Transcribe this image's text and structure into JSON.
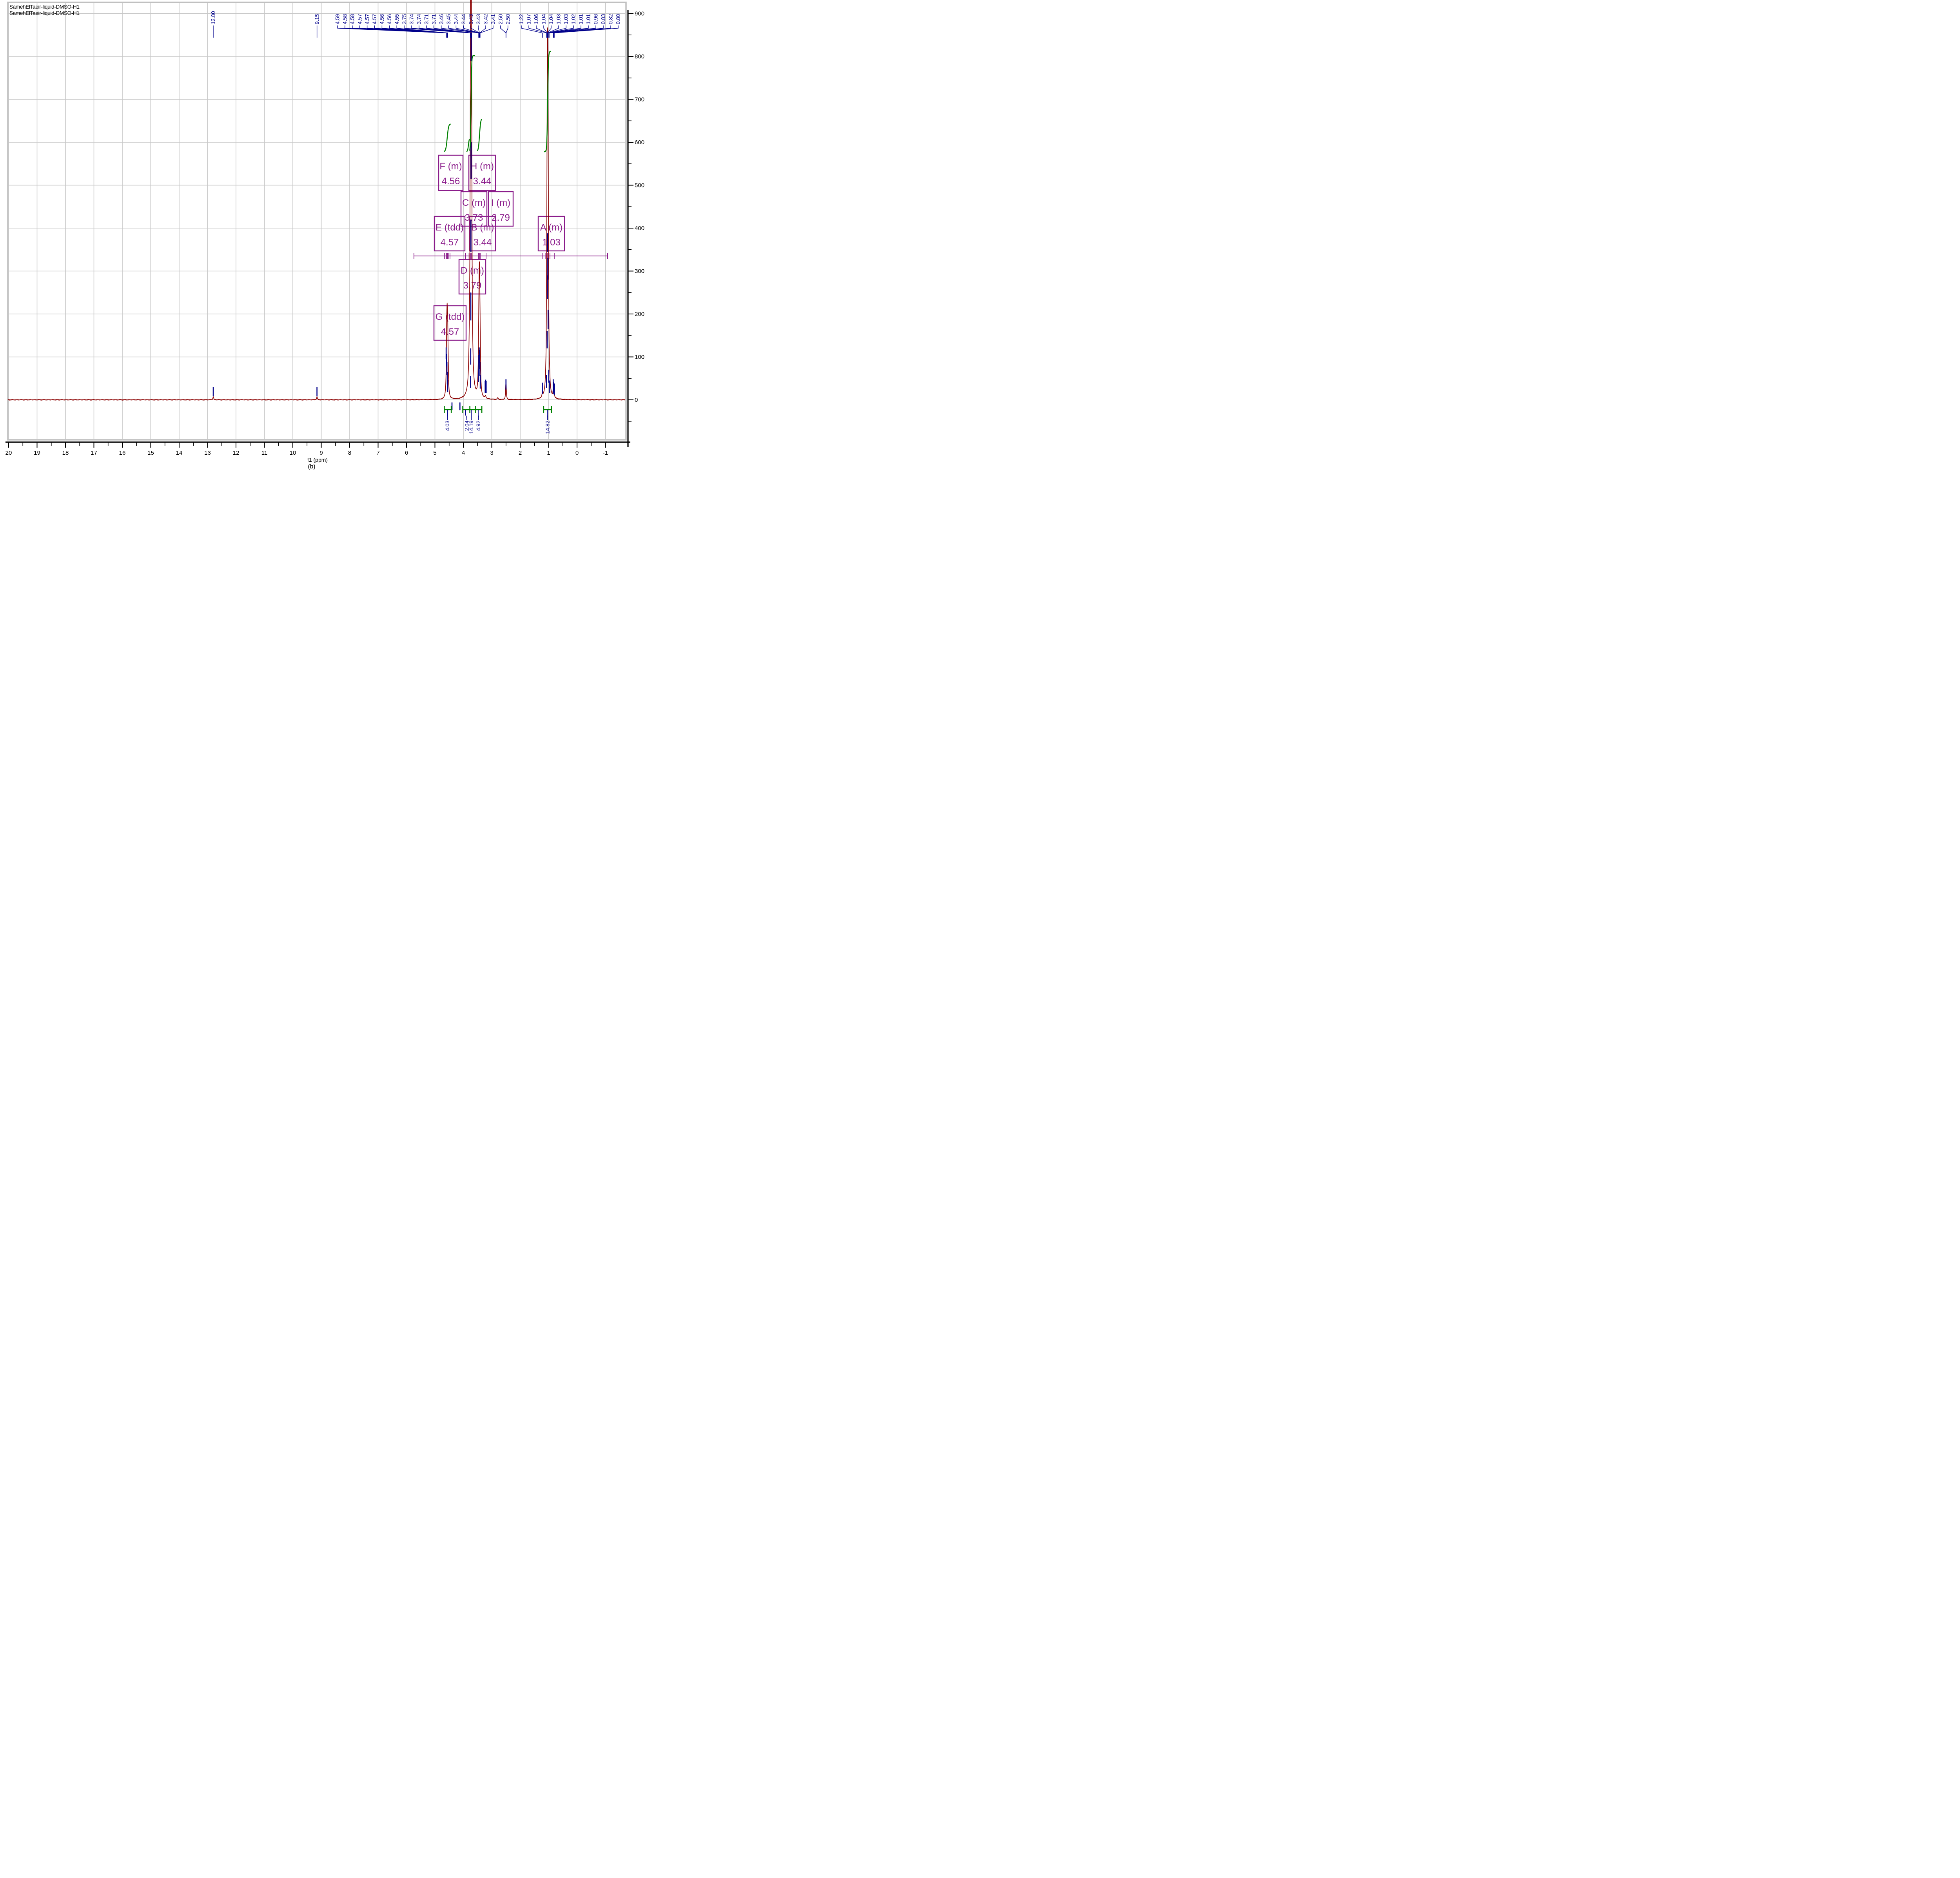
{
  "header": {
    "title_line1": "SamehElTaeir-liquid-DMSO-H1",
    "title_line2": "SamehElTaeir-liquid-DMSO-H1"
  },
  "caption": "(b)",
  "chart_data": {
    "type": "line",
    "title": "SamehElTaeir-liquid-DMSO-H1",
    "xlabel": "f1 (ppm)",
    "ylabel": "",
    "x_axis": {
      "label": "f1 (ppm)",
      "range": [
        20,
        -1
      ],
      "major_tick_step": 1,
      "minor_tick_step": 0.5,
      "tick_labels": [
        "20",
        "19",
        "18",
        "17",
        "16",
        "15",
        "14",
        "13",
        "12",
        "11",
        "10",
        "9",
        "8",
        "7",
        "6",
        "5",
        "4",
        "3",
        "2",
        "1",
        "0",
        "-1"
      ]
    },
    "y_axis": {
      "range": [
        0,
        900
      ],
      "major_tick_step": 100,
      "minor_tick_step": 50,
      "tick_labels": [
        "900",
        "800",
        "700",
        "600",
        "500",
        "400",
        "300",
        "200",
        "100",
        "0"
      ]
    },
    "grid": true,
    "peak_pick_clusters": [
      {
        "labels": [
          {
            "text": "12.80",
            "ppm": 12.8
          }
        ]
      },
      {
        "labels": [
          {
            "text": "9.15",
            "ppm": 9.15
          }
        ]
      },
      {
        "labels": [
          {
            "text": "4.59",
            "ppm": 4.59
          },
          {
            "text": "4.58",
            "ppm": 4.58
          },
          {
            "text": "4.58",
            "ppm": 4.58
          },
          {
            "text": "4.57",
            "ppm": 4.57
          },
          {
            "text": "4.57",
            "ppm": 4.57
          },
          {
            "text": "4.57",
            "ppm": 4.57
          },
          {
            "text": "4.56",
            "ppm": 4.56
          },
          {
            "text": "4.56",
            "ppm": 4.56
          },
          {
            "text": "4.55",
            "ppm": 4.55
          },
          {
            "text": "3.75",
            "ppm": 3.75
          },
          {
            "text": "3.74",
            "ppm": 3.74
          },
          {
            "text": "3.74",
            "ppm": 3.74
          },
          {
            "text": "3.71",
            "ppm": 3.71
          },
          {
            "text": "3.71",
            "ppm": 3.71
          },
          {
            "text": "3.46",
            "ppm": 3.46
          },
          {
            "text": "3.45",
            "ppm": 3.45
          },
          {
            "text": "3.44",
            "ppm": 3.44
          },
          {
            "text": "3.44",
            "ppm": 3.44
          },
          {
            "text": "3.43",
            "ppm": 3.43
          },
          {
            "text": "3.43",
            "ppm": 3.43
          },
          {
            "text": "3.42",
            "ppm": 3.42
          },
          {
            "text": "3.41",
            "ppm": 3.41
          },
          {
            "text": "2.50",
            "ppm": 2.502
          },
          {
            "text": "2.50",
            "ppm": 2.498
          }
        ]
      },
      {
        "labels": [
          {
            "text": "1.22",
            "ppm": 1.22
          },
          {
            "text": "1.07",
            "ppm": 1.07
          },
          {
            "text": "1.06",
            "ppm": 1.06
          },
          {
            "text": "1.04",
            "ppm": 1.045
          },
          {
            "text": "1.04",
            "ppm": 1.04
          },
          {
            "text": "1.03",
            "ppm": 1.035
          },
          {
            "text": "1.03",
            "ppm": 1.03
          },
          {
            "text": "1.02",
            "ppm": 1.02
          },
          {
            "text": "1.01",
            "ppm": 1.012
          },
          {
            "text": "1.01",
            "ppm": 1.008
          },
          {
            "text": "0.96",
            "ppm": 0.96
          },
          {
            "text": "0.83",
            "ppm": 0.83
          },
          {
            "text": "0.82",
            "ppm": 0.82
          },
          {
            "text": "0.80",
            "ppm": 0.8
          }
        ]
      }
    ],
    "multiplets": [
      {
        "id": "F",
        "type": "m",
        "shift": "4.56",
        "label_line1": "F (m)",
        "label_line2": "4.56"
      },
      {
        "id": "H",
        "type": "m",
        "shift": "3.44",
        "label_line1": "H (m)",
        "label_line2": "3.44"
      },
      {
        "id": "C",
        "type": "m",
        "shift": "3.73",
        "label_line1": "C (m)",
        "label_line2": "3.73"
      },
      {
        "id": "I",
        "type": "m",
        "shift": "2.79",
        "label_line1": "I (m)",
        "label_line2": "2.79"
      },
      {
        "id": "E",
        "type": "tdd",
        "shift": "4.57",
        "label_line1": "E (tdd)",
        "label_line2": "4.57"
      },
      {
        "id": "B",
        "type": "m",
        "shift": "3.44",
        "label_line1": "B (m)",
        "label_line2": "3.44"
      },
      {
        "id": "A",
        "type": "m",
        "shift": "1.03",
        "label_line1": "A (m)",
        "label_line2": "1.03"
      },
      {
        "id": "D",
        "type": "m",
        "shift": "3.79",
        "label_line1": "D (m)",
        "label_line2": "3.79"
      },
      {
        "id": "G",
        "type": "tdd",
        "shift": "4.57",
        "label_line1": "G (tdd)",
        "label_line2": "4.57"
      }
    ],
    "integrals": [
      {
        "value": "4.03",
        "from": 4.67,
        "to": 4.425,
        "leader_from": 4.555,
        "label_at": 4.56
      },
      {
        "value": "2.04",
        "from": 4.02,
        "to": 3.77,
        "leader_from": 3.92,
        "label_at": 3.88
      },
      {
        "value": "14.19",
        "from": 3.77,
        "to": 3.565,
        "leader_from": 3.72,
        "label_at": 3.72
      },
      {
        "value": "4.92",
        "from": 3.565,
        "to": 3.35,
        "leader_from": 3.46,
        "label_at": 3.47
      },
      {
        "value": "14.82",
        "from": 1.175,
        "to": 0.9,
        "leader_from": 1.035,
        "label_at": 1.04
      }
    ],
    "integral_curves": [
      {
        "from": 4.665,
        "to": 4.455,
        "center": 4.568,
        "w": 3.5,
        "I0": 578,
        "I1": 643
      },
      {
        "from": 3.875,
        "to": 3.788,
        "center": 3.82,
        "w": 2.2,
        "I0": 578,
        "I1": 611
      },
      {
        "from": 3.775,
        "to": 3.6,
        "center": 3.729,
        "w": 1.6,
        "I0": 578,
        "I1": 802
      },
      {
        "from": 3.5,
        "to": 3.355,
        "center": 3.43,
        "w": 3.0,
        "I0": 578,
        "I1": 656
      },
      {
        "from": 1.155,
        "to": 0.925,
        "center": 1.034,
        "w": 2.0,
        "I0": 578,
        "I1": 812
      }
    ],
    "peaks": [
      [
        12.8,
        7,
        1.2
      ],
      [
        9.15,
        7,
        1.2
      ],
      [
        4.6,
        22,
        0.9
      ],
      [
        4.585,
        95,
        1.0
      ],
      [
        4.57,
        128,
        1.1
      ],
      [
        4.552,
        108,
        1.1
      ],
      [
        4.535,
        38,
        1.0
      ],
      [
        3.8,
        13,
        0.9
      ],
      [
        3.785,
        26,
        0.9
      ],
      [
        3.77,
        17,
        0.9
      ],
      [
        3.752,
        110,
        1.0
      ],
      [
        3.74,
        420,
        1.1
      ],
      [
        3.731,
        845,
        1.3
      ],
      [
        3.722,
        560,
        1.1
      ],
      [
        3.712,
        150,
        1.0
      ],
      [
        3.465,
        45,
        1.0
      ],
      [
        3.452,
        82,
        1.0
      ],
      [
        3.441,
        105,
        1.1
      ],
      [
        3.432,
        118,
        1.1
      ],
      [
        3.423,
        92,
        1.0
      ],
      [
        3.412,
        58,
        1.0
      ],
      [
        3.4,
        26,
        0.9
      ],
      [
        3.22,
        6,
        1.2
      ],
      [
        2.79,
        4,
        1.2
      ],
      [
        2.507,
        13,
        0.8
      ],
      [
        2.5,
        22,
        0.9
      ],
      [
        2.493,
        13,
        0.8
      ],
      [
        1.22,
        9,
        1.0
      ],
      [
        1.07,
        45,
        0.9
      ],
      [
        1.058,
        130,
        1.0
      ],
      [
        1.046,
        300,
        1.1
      ],
      [
        1.035,
        385,
        1.2
      ],
      [
        1.024,
        310,
        1.1
      ],
      [
        1.012,
        140,
        1.0
      ],
      [
        1.0,
        55,
        0.9
      ],
      [
        0.96,
        11,
        0.9
      ],
      [
        0.838,
        13,
        0.9
      ],
      [
        0.82,
        9,
        0.9
      ],
      [
        0.8,
        7,
        0.9
      ]
    ],
    "pick_ticks": [
      [
        12.8,
        8,
        30
      ],
      [
        9.15,
        8,
        30
      ],
      [
        4.605,
        95,
        122
      ],
      [
        4.592,
        78,
        107
      ],
      [
        4.578,
        58,
        88
      ],
      [
        4.565,
        36,
        65
      ],
      [
        4.551,
        18,
        46
      ],
      [
        3.745,
        28,
        55
      ],
      [
        3.741,
        82,
        120
      ],
      [
        3.737,
        185,
        250
      ],
      [
        3.733,
        345,
        420
      ],
      [
        3.729,
        515,
        600
      ],
      [
        3.726,
        790,
        855
      ],
      [
        3.468,
        42,
        72
      ],
      [
        3.455,
        72,
        105
      ],
      [
        3.443,
        92,
        122
      ],
      [
        3.43,
        86,
        116
      ],
      [
        3.418,
        55,
        88
      ],
      [
        3.405,
        26,
        58
      ],
      [
        3.232,
        16,
        44
      ],
      [
        3.215,
        18,
        47
      ],
      [
        3.198,
        16,
        44
      ],
      [
        2.5,
        24,
        48
      ],
      [
        1.22,
        14,
        40
      ],
      [
        1.075,
        28,
        58
      ],
      [
        1.052,
        120,
        160
      ],
      [
        1.043,
        235,
        290
      ],
      [
        1.036,
        345,
        388
      ],
      [
        1.028,
        280,
        330
      ],
      [
        1.018,
        165,
        210
      ],
      [
        0.995,
        40,
        70
      ],
      [
        0.96,
        16,
        45
      ],
      [
        0.838,
        18,
        48
      ],
      [
        0.822,
        14,
        42
      ],
      [
        0.8,
        12,
        38
      ],
      [
        4.4,
        -24,
        -6
      ],
      [
        4.12,
        -24,
        -6
      ]
    ],
    "ruler_ticks_ppm": [
      4.665,
      4.61,
      4.585,
      4.57,
      4.555,
      4.53,
      4.47,
      3.92,
      3.8,
      3.755,
      3.73,
      3.705,
      3.47,
      3.445,
      3.42,
      3.39,
      3.2,
      1.225,
      1.1,
      1.035,
      0.955,
      0.8
    ],
    "colors": {
      "spectrum": "#8B0000",
      "peak_labels": "#00008B",
      "integral_curve": "#008000",
      "integral_bracket": "#008000",
      "integral_text": "#00008B",
      "multiplet_box": "#8B1D8B",
      "grid": "#C8C8C8",
      "frame": "#C0C0C0",
      "axis": "#000000"
    }
  }
}
